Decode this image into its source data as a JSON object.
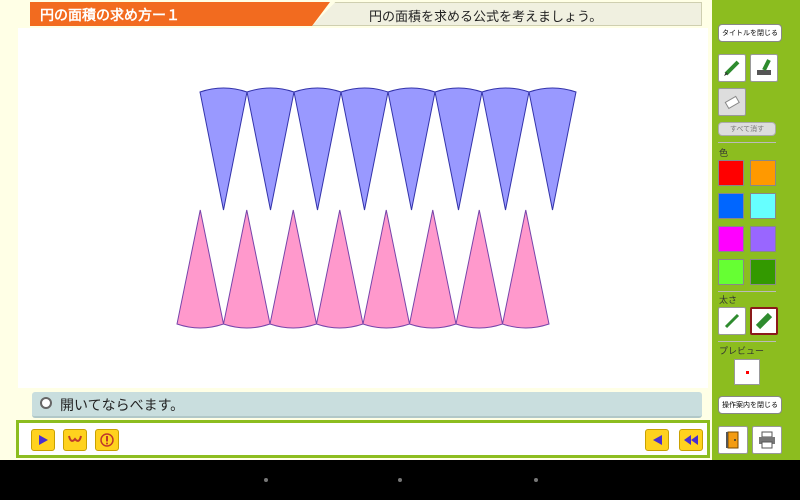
{
  "header": {
    "title": "円の面積の求め方ー１",
    "subtitle": "円の面積を求める公式を考えましょう。"
  },
  "caption": {
    "text": "開いてならべます。"
  },
  "panel": {
    "close_title_label": "タイトルを閉じる",
    "clear_all_label": "すべて消す",
    "color_label": "色",
    "thickness_label": "太さ",
    "preview_label": "プレビュー",
    "close_guide_label": "操作案内を閉じる",
    "colors": [
      "#ff0000",
      "#ff9900",
      "#0066ff",
      "#66ffff",
      "#ff00ff",
      "#9966ff",
      "#66ff33",
      "#339900"
    ]
  },
  "shapes": {
    "top_color": "#9999ff",
    "bottom_color": "#ff99cc",
    "slice_count_each_row": 8
  },
  "icons": {
    "play": "play-icon",
    "mustache": "mustache-icon",
    "warning": "warning-icon",
    "back": "back-icon",
    "rewind": "rewind-icon",
    "pen": "pen-icon",
    "marker": "marker-icon",
    "eraser": "eraser-icon",
    "door": "door-icon",
    "print": "print-icon"
  }
}
